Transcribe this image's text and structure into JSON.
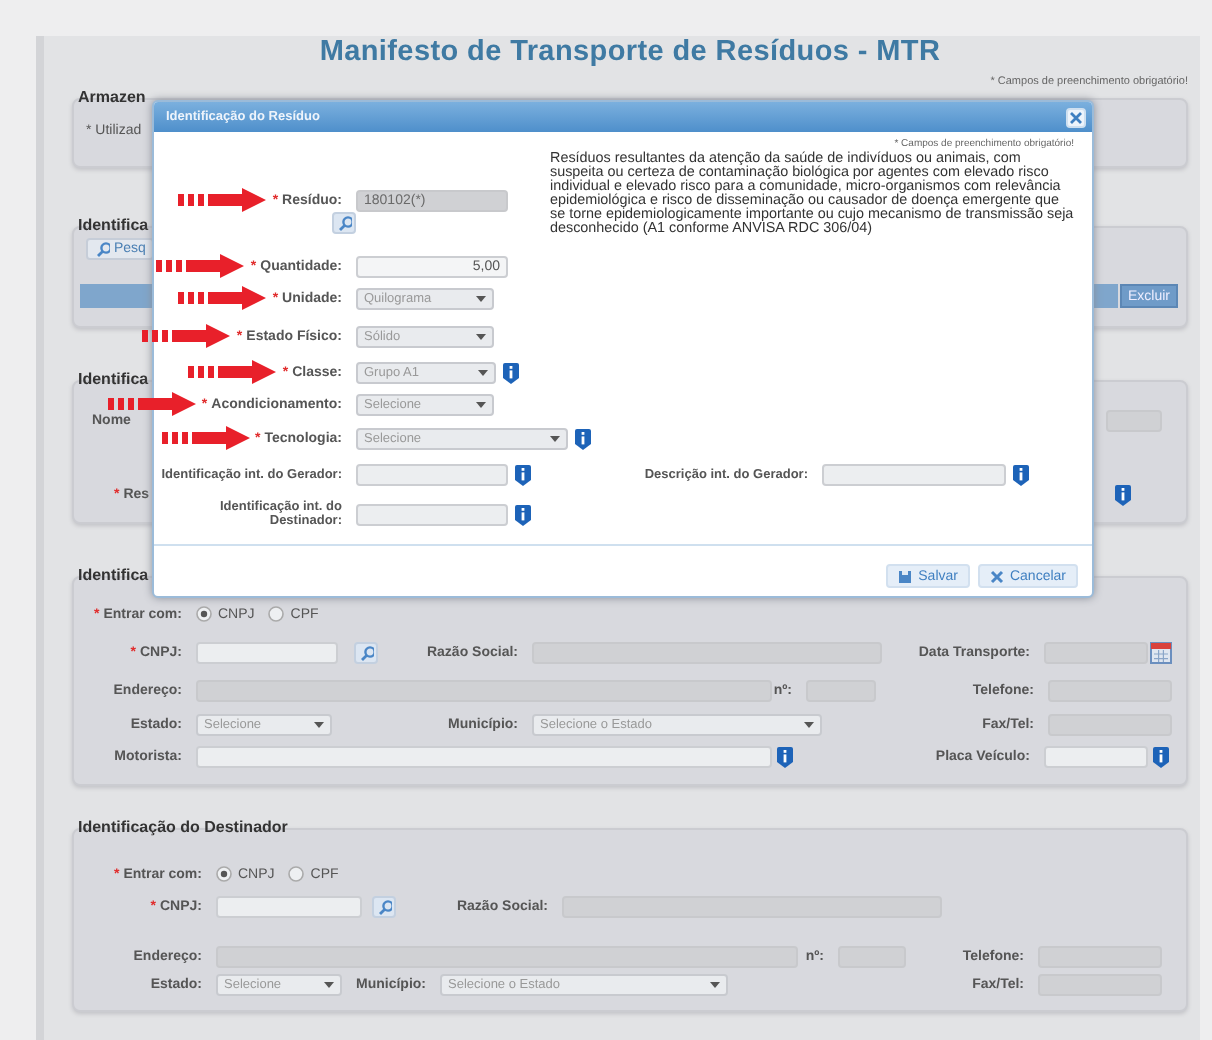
{
  "page": {
    "title": "Manifesto de Transporte de Resíduos - MTR",
    "required_note": "* Campos de preenchimento obrigatório!"
  },
  "storage": {
    "heading": "Armazen",
    "note": "* Utilizad"
  },
  "section_2": {
    "heading": "Identifica",
    "search_button": "Pesq",
    "delete_button": "Excluir"
  },
  "section_3": {
    "heading": "Identifica",
    "label": "Nome",
    "required_label": {
      "kind": "label",
      "mark": "*",
      "text": "Res"
    }
  },
  "carrier": {
    "heading": "Identifica",
    "rows": [
      {
        "left": [
          {
            "kind": "label",
            "mark": "*",
            "text": "Entrar com:"
          },
          {
            "kind": "radio_group",
            "options": [
              {
                "label": "CNPJ",
                "selected": true
              },
              {
                "label": "CPF",
                "selected": false
              }
            ]
          }
        ]
      },
      {
        "left": [
          {
            "kind": "label",
            "mark": "*",
            "text": "CNPJ:"
          },
          {
            "kind": "input"
          },
          {
            "kind": "search_button"
          }
        ],
        "middle": [
          {
            "kind": "label",
            "text": "Razão Social:"
          },
          {
            "kind": "readonly"
          }
        ],
        "right": [
          {
            "kind": "label",
            "text": "Data Transporte:"
          },
          {
            "kind": "readonly"
          },
          {
            "kind": "calendar_button"
          }
        ]
      },
      {
        "left": [
          {
            "kind": "label",
            "text": "Endereço:"
          },
          {
            "kind": "readonly"
          }
        ],
        "middle": [
          {
            "kind": "label",
            "text": "nº:"
          },
          {
            "kind": "readonly"
          }
        ],
        "right": [
          {
            "kind": "label",
            "text": "Telefone:"
          },
          {
            "kind": "readonly"
          }
        ]
      },
      {
        "left": [
          {
            "kind": "label",
            "text": "Estado:"
          },
          {
            "kind": "select",
            "value": "Selecione"
          }
        ],
        "middle": [
          {
            "kind": "label",
            "text": "Município:"
          },
          {
            "kind": "select",
            "value": "Selecione o Estado"
          }
        ],
        "right": [
          {
            "kind": "label",
            "text": "Fax/Tel:"
          },
          {
            "kind": "readonly"
          }
        ]
      },
      {
        "left": [
          {
            "kind": "label",
            "text": "Motorista:"
          },
          {
            "kind": "input"
          },
          {
            "kind": "info_button"
          }
        ],
        "right": [
          {
            "kind": "label",
            "text": "Placa Veículo:"
          },
          {
            "kind": "input"
          },
          {
            "kind": "info_button"
          }
        ]
      }
    ]
  },
  "receiver": {
    "heading": "Identificação do Destinador",
    "rows": [
      {
        "left": [
          {
            "kind": "label",
            "mark": "*",
            "text": "Entrar com:"
          },
          {
            "kind": "radio_group",
            "options": [
              {
                "label": "CNPJ",
                "selected": true
              },
              {
                "label": "CPF",
                "selected": false
              }
            ]
          }
        ]
      },
      {
        "left": [
          {
            "kind": "label",
            "mark": "*",
            "text": "CNPJ:"
          },
          {
            "kind": "input"
          },
          {
            "kind": "search_button"
          }
        ],
        "middle": [
          {
            "kind": "label",
            "text": "Razão Social:"
          },
          {
            "kind": "readonly"
          }
        ]
      },
      {
        "left": [
          {
            "kind": "label",
            "text": "Endereço:"
          },
          {
            "kind": "readonly"
          }
        ],
        "middle": [
          {
            "kind": "label",
            "text": "nº:"
          },
          {
            "kind": "readonly"
          }
        ],
        "right": [
          {
            "kind": "label",
            "text": "Telefone:"
          },
          {
            "kind": "readonly"
          }
        ]
      },
      {
        "left": [
          {
            "kind": "label",
            "text": "Estado:"
          },
          {
            "kind": "select",
            "value": "Selecione"
          }
        ],
        "middle": [
          {
            "kind": "label",
            "text": "Município:"
          },
          {
            "kind": "select",
            "value": "Selecione o Estado"
          }
        ],
        "right": [
          {
            "kind": "label",
            "text": "Fax/Tel:"
          },
          {
            "kind": "readonly"
          }
        ]
      }
    ]
  },
  "dialog": {
    "title": "Identificação do Resíduo",
    "required_note": "* Campos de preenchimento obrigatório!",
    "description": "Resíduos resultantes da atenção da saúde de indivíduos ou animais, com suspeita ou certeza de contaminação biológica por agentes com elevado risco individual e elevado risco para a comunidade, micro-organismos com relevância epidemiológica e risco de disseminação ou causador de doença emergente que se torne epidemiologicamente importante ou cujo mecanismo de transmissão seja desconhecido (A1 conforme ANVISA RDC 306/04)",
    "top_row": [
      {
        "kind": "label",
        "arrow": true,
        "mark": "*",
        "text": "Resíduo:"
      },
      {
        "kind": "readonly",
        "value": "180102(*)"
      },
      {
        "kind": "search_button"
      }
    ],
    "rows": [
      [
        {
          "kind": "label",
          "arrow": true,
          "mark": "*",
          "text": "Quantidade:"
        },
        {
          "kind": "number",
          "value": "5,00"
        }
      ],
      [
        {
          "kind": "label",
          "arrow": true,
          "mark": "*",
          "text": "Unidade:"
        },
        {
          "kind": "select",
          "value": "Quilograma"
        }
      ],
      [
        {
          "kind": "label",
          "arrow": true,
          "mark": "*",
          "text": "Estado Físico:"
        },
        {
          "kind": "select",
          "value": "Sólido"
        }
      ],
      [
        {
          "kind": "label",
          "arrow": true,
          "mark": "*",
          "text": "Classe:"
        },
        {
          "kind": "select",
          "value": "Grupo A1"
        },
        {
          "kind": "info_button"
        }
      ],
      [
        {
          "kind": "label",
          "arrow": true,
          "mark": "*",
          "text": "Acondicionamento:"
        },
        {
          "kind": "select",
          "value": "Selecione"
        }
      ],
      [
        {
          "kind": "label",
          "arrow": true,
          "mark": "*",
          "text": "Tecnologia:"
        },
        {
          "kind": "select",
          "value": "Selecione"
        },
        {
          "kind": "info_button"
        }
      ],
      [
        {
          "kind": "label",
          "text": "Identificação int. do Gerador:"
        },
        {
          "kind": "input"
        },
        {
          "kind": "info_button"
        },
        {
          "kind": "label",
          "text": "Descrição int. do Gerador:"
        },
        {
          "kind": "input"
        },
        {
          "kind": "info_button"
        }
      ],
      [
        {
          "kind": "label",
          "text": "Identificação int. do Destinador:"
        },
        {
          "kind": "input"
        },
        {
          "kind": "info_button"
        }
      ]
    ],
    "buttons": [
      {
        "kind": "save",
        "label": "Salvar"
      },
      {
        "kind": "cancel",
        "label": "Cancelar"
      }
    ]
  }
}
